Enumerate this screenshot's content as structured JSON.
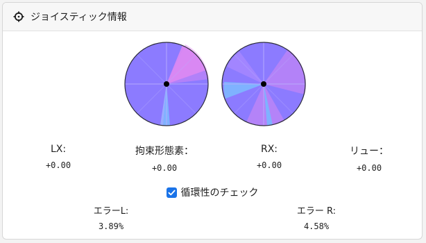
{
  "panel": {
    "title": "ジョイスティック情報",
    "icon": "crosshair-icon"
  },
  "sticks": {
    "left": {
      "name": "left-stick-circularity"
    },
    "right": {
      "name": "right-stick-circularity"
    }
  },
  "values": [
    {
      "label": "LX:",
      "value": "+0.00"
    },
    {
      "label": "拘束形態素：",
      "value": "+0.00"
    },
    {
      "label": "RX:",
      "value": "+0.00"
    },
    {
      "label": "リュー：",
      "value": "+0.00"
    }
  ],
  "circularity_check": {
    "label": "循環性のチェック",
    "checked": true
  },
  "errors": {
    "left": {
      "label": "エラーL:",
      "value": "3.89%"
    },
    "right": {
      "label": "エラー R:",
      "value": "4.58%"
    }
  },
  "colors": {
    "accent": "#1a73e8",
    "fill_main": "#8c7bff",
    "fill_pink": "#e08af2",
    "fill_blue": "#7fb2ff"
  }
}
